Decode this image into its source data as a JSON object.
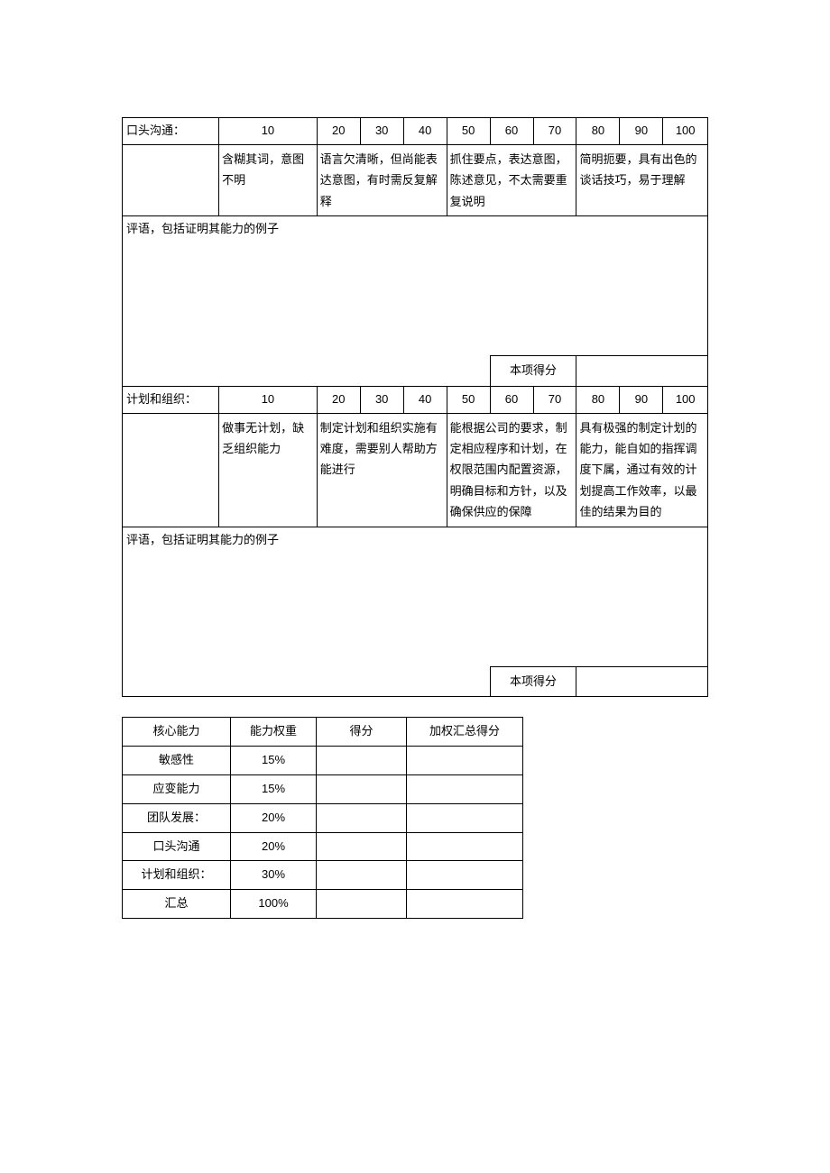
{
  "sections": [
    {
      "label": "口头沟通：",
      "scores": [
        "10",
        "20",
        "30",
        "40",
        "50",
        "60",
        "70",
        "80",
        "90",
        "100"
      ],
      "descs": [
        "含糊其词，意图不明",
        "语言欠清晰，但尚能表达意图，有时需反复解释",
        "抓住要点，表达意图，陈述意见，不太需要重复说明",
        "简明扼要，具有出色的谈话技巧，易于理解"
      ],
      "comment_label": "评语，包括证明其能力的例子",
      "score_label": "本项得分",
      "score_value": ""
    },
    {
      "label": "计划和组织：",
      "scores": [
        "10",
        "20",
        "30",
        "40",
        "50",
        "60",
        "70",
        "80",
        "90",
        "100"
      ],
      "descs": [
        "做事无计划，缺乏组织能力",
        "制定计划和组织实施有难度，需要别人帮助方能进行",
        "能根据公司的要求，制定相应程序和计划，在权限范围内配置资源，明确目标和方针，以及确保供应的保障",
        "具有极强的制定计划的能力，能自如的指挥调度下属，通过有效的计划提高工作效率，以最佳的结果为目的"
      ],
      "comment_label": "评语，包括证明其能力的例子",
      "score_label": "本项得分",
      "score_value": ""
    }
  ],
  "summary": {
    "headers": [
      "核心能力",
      "能力权重",
      "得分",
      "加权汇总得分"
    ],
    "rows": [
      {
        "name": "敏感性",
        "weight": "15%",
        "score": "",
        "weighted": ""
      },
      {
        "name": "应变能力",
        "weight": "15%",
        "score": "",
        "weighted": ""
      },
      {
        "name": "团队发展：",
        "weight": "20%",
        "score": "",
        "weighted": ""
      },
      {
        "name": "口头沟通",
        "weight": "20%",
        "score": "",
        "weighted": ""
      },
      {
        "name": "计划和组织：",
        "weight": "30%",
        "score": "",
        "weighted": ""
      },
      {
        "name": "汇总",
        "weight": "100%",
        "score": "",
        "weighted": ""
      }
    ]
  }
}
